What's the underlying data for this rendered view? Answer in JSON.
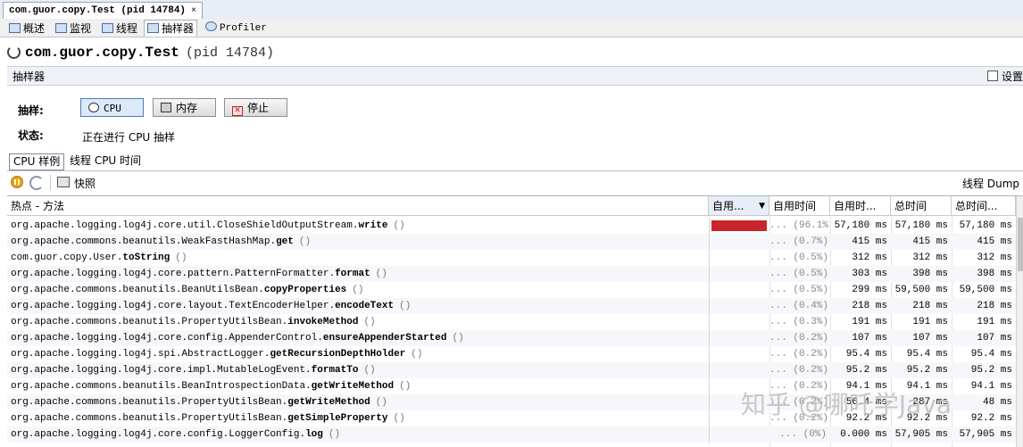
{
  "doc_tab": {
    "title": "com.guor.copy.Test (pid 14784)",
    "close": "×"
  },
  "view_tabs": [
    {
      "label": "概述"
    },
    {
      "label": "监视"
    },
    {
      "label": "线程"
    },
    {
      "label": "抽样器"
    },
    {
      "label": "Profiler"
    }
  ],
  "header": {
    "app": "com.guor.copy.Test",
    "pid": "(pid 14784)"
  },
  "sampler": {
    "title": "抽样器",
    "settings_label": "设置"
  },
  "controls": {
    "sample_label": "抽样:",
    "status_label": "状态:",
    "cpu_button": "CPU",
    "memory_button": "内存",
    "stop_button": "停止",
    "status_text": "正在进行 CPU 抽样"
  },
  "sub_tabs": [
    {
      "label": "CPU 样例"
    },
    {
      "label": "线程 CPU 时间"
    }
  ],
  "toolbar": {
    "snapshot_label": "快照",
    "thread_dump": "线程 Dump"
  },
  "table": {
    "headers": {
      "method": "热点 - 方法",
      "self_time_bar": "自用...",
      "self_time": "自用时间",
      "self_time_cpu": "自用时...",
      "total_time": "总时间",
      "total_time_cpu": "总时间..."
    },
    "rows": [
      {
        "pkg": "org.apache.logging.log4j.core.util.CloseShieldOutputStream.",
        "method": "write",
        "args": "()",
        "bar_fraction": 0.961,
        "pct": "... (96.1%)",
        "self": "57,180 ms",
        "total": "57,180 ms",
        "total2": "57,180 ms"
      },
      {
        "pkg": "org.apache.commons.beanutils.WeakFastHashMap.",
        "method": "get",
        "args": "()",
        "bar_fraction": 0.007,
        "pct": "... (0.7%)",
        "self": "415 ms",
        "total": "415 ms",
        "total2": "415 ms"
      },
      {
        "pkg": "com.guor.copy.User.",
        "method": "toString",
        "args": "()",
        "bar_fraction": 0.005,
        "pct": "... (0.5%)",
        "self": "312 ms",
        "total": "312 ms",
        "total2": "312 ms"
      },
      {
        "pkg": "org.apache.logging.log4j.core.pattern.PatternFormatter.",
        "method": "format",
        "args": "()",
        "bar_fraction": 0.005,
        "pct": "... (0.5%)",
        "self": "303 ms",
        "total": "398 ms",
        "total2": "398 ms"
      },
      {
        "pkg": "org.apache.commons.beanutils.BeanUtilsBean.",
        "method": "copyProperties",
        "args": "()",
        "bar_fraction": 0.005,
        "pct": "... (0.5%)",
        "self": "299 ms",
        "total": "59,500 ms",
        "total2": "59,500 ms"
      },
      {
        "pkg": "org.apache.logging.log4j.core.layout.TextEncoderHelper.",
        "method": "encodeText",
        "args": "()",
        "bar_fraction": 0.004,
        "pct": "... (0.4%)",
        "self": "218 ms",
        "total": "218 ms",
        "total2": "218 ms"
      },
      {
        "pkg": "org.apache.commons.beanutils.PropertyUtilsBean.",
        "method": "invokeMethod",
        "args": "()",
        "bar_fraction": 0.003,
        "pct": "... (0.3%)",
        "self": "191 ms",
        "total": "191 ms",
        "total2": "191 ms"
      },
      {
        "pkg": "org.apache.logging.log4j.core.config.AppenderControl.",
        "method": "ensureAppenderStarted",
        "args": "()",
        "bar_fraction": 0.002,
        "pct": "... (0.2%)",
        "self": "107 ms",
        "total": "107 ms",
        "total2": "107 ms"
      },
      {
        "pkg": "org.apache.logging.log4j.spi.AbstractLogger.",
        "method": "getRecursionDepthHolder",
        "args": "()",
        "bar_fraction": 0.002,
        "pct": "... (0.2%)",
        "self": "95.4 ms",
        "total": "95.4 ms",
        "total2": "95.4 ms"
      },
      {
        "pkg": "org.apache.logging.log4j.core.impl.MutableLogEvent.",
        "method": "formatTo",
        "args": "()",
        "bar_fraction": 0.002,
        "pct": "... (0.2%)",
        "self": "95.2 ms",
        "total": "95.2 ms",
        "total2": "95.2 ms"
      },
      {
        "pkg": "org.apache.commons.beanutils.BeanIntrospectionData.",
        "method": "getWriteMethod",
        "args": "()",
        "bar_fraction": 0.002,
        "pct": "... (0.2%)",
        "self": "94.1 ms",
        "total": "94.1 ms",
        "total2": "94.1 ms"
      },
      {
        "pkg": "org.apache.commons.beanutils.PropertyUtilsBean.",
        "method": "getWriteMethod",
        "args": "()",
        "bar_fraction": 0.002,
        "pct": "... (0.2%)",
        "self": "56.4 ms",
        "total": "287 ms",
        "total2": "48 ms"
      },
      {
        "pkg": "org.apache.commons.beanutils.PropertyUtilsBean.",
        "method": "getSimpleProperty",
        "args": "()",
        "bar_fraction": 0.002,
        "pct": "... (0.2%)",
        "self": "92.2 ms",
        "total": "92.2 ms",
        "total2": "92.2 ms"
      },
      {
        "pkg": "org.apache.logging.log4j.core.config.LoggerConfig.",
        "method": "log",
        "args": "()",
        "bar_fraction": 0.0,
        "pct": "... (0%)",
        "self": "0.000 ms",
        "total": "57,905 ms",
        "total2": "57,905 ms"
      }
    ]
  },
  "watermark": "知乎 @哪吒学Java",
  "colors": {
    "bar": "#c7262c",
    "accent": "#4d7db8"
  }
}
